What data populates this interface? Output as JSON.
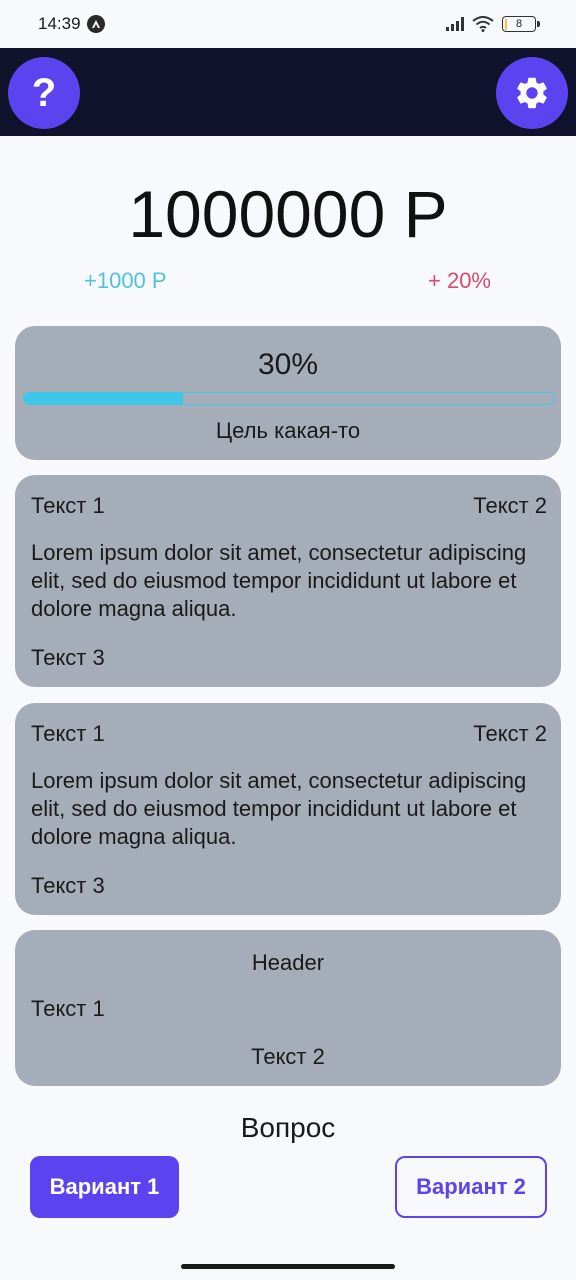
{
  "status_bar": {
    "time": "14:39",
    "battery": "8",
    "battery_level": 0.08
  },
  "app_bar": {
    "help_icon": "question-icon",
    "help_label": "?",
    "settings_icon": "gear-icon",
    "background": "#11132c",
    "accent": "#5b43f0"
  },
  "summary": {
    "balance": "1000000 Р",
    "delta_amount": "+1000 Р",
    "delta_percent": "+ 20%"
  },
  "goal": {
    "percent_label": "30%",
    "progress": 0.3,
    "name": "Цель какая-то"
  },
  "cards": [
    {
      "text1": "Текст 1",
      "text2": "Текст 2",
      "body": "Lorem ipsum dolor sit amet, consectetur adipiscing elit, sed do eiusmod tempor incididunt ut labore et dolore magna aliqua.",
      "text3": "Текст 3"
    },
    {
      "text1": "Текст 1",
      "text2": "Текст 2",
      "body": "Lorem ipsum dolor sit amet, consectetur adipiscing elit, sed do eiusmod tempor incididunt ut labore et dolore magna aliqua.",
      "text3": "Текст 3"
    }
  ],
  "header_card": {
    "header": "Header",
    "text1": "Текст 1",
    "text2": "Текст 2"
  },
  "question": {
    "title": "Вопрос",
    "option1": "Вариант 1",
    "option2": "Вариант 2"
  }
}
